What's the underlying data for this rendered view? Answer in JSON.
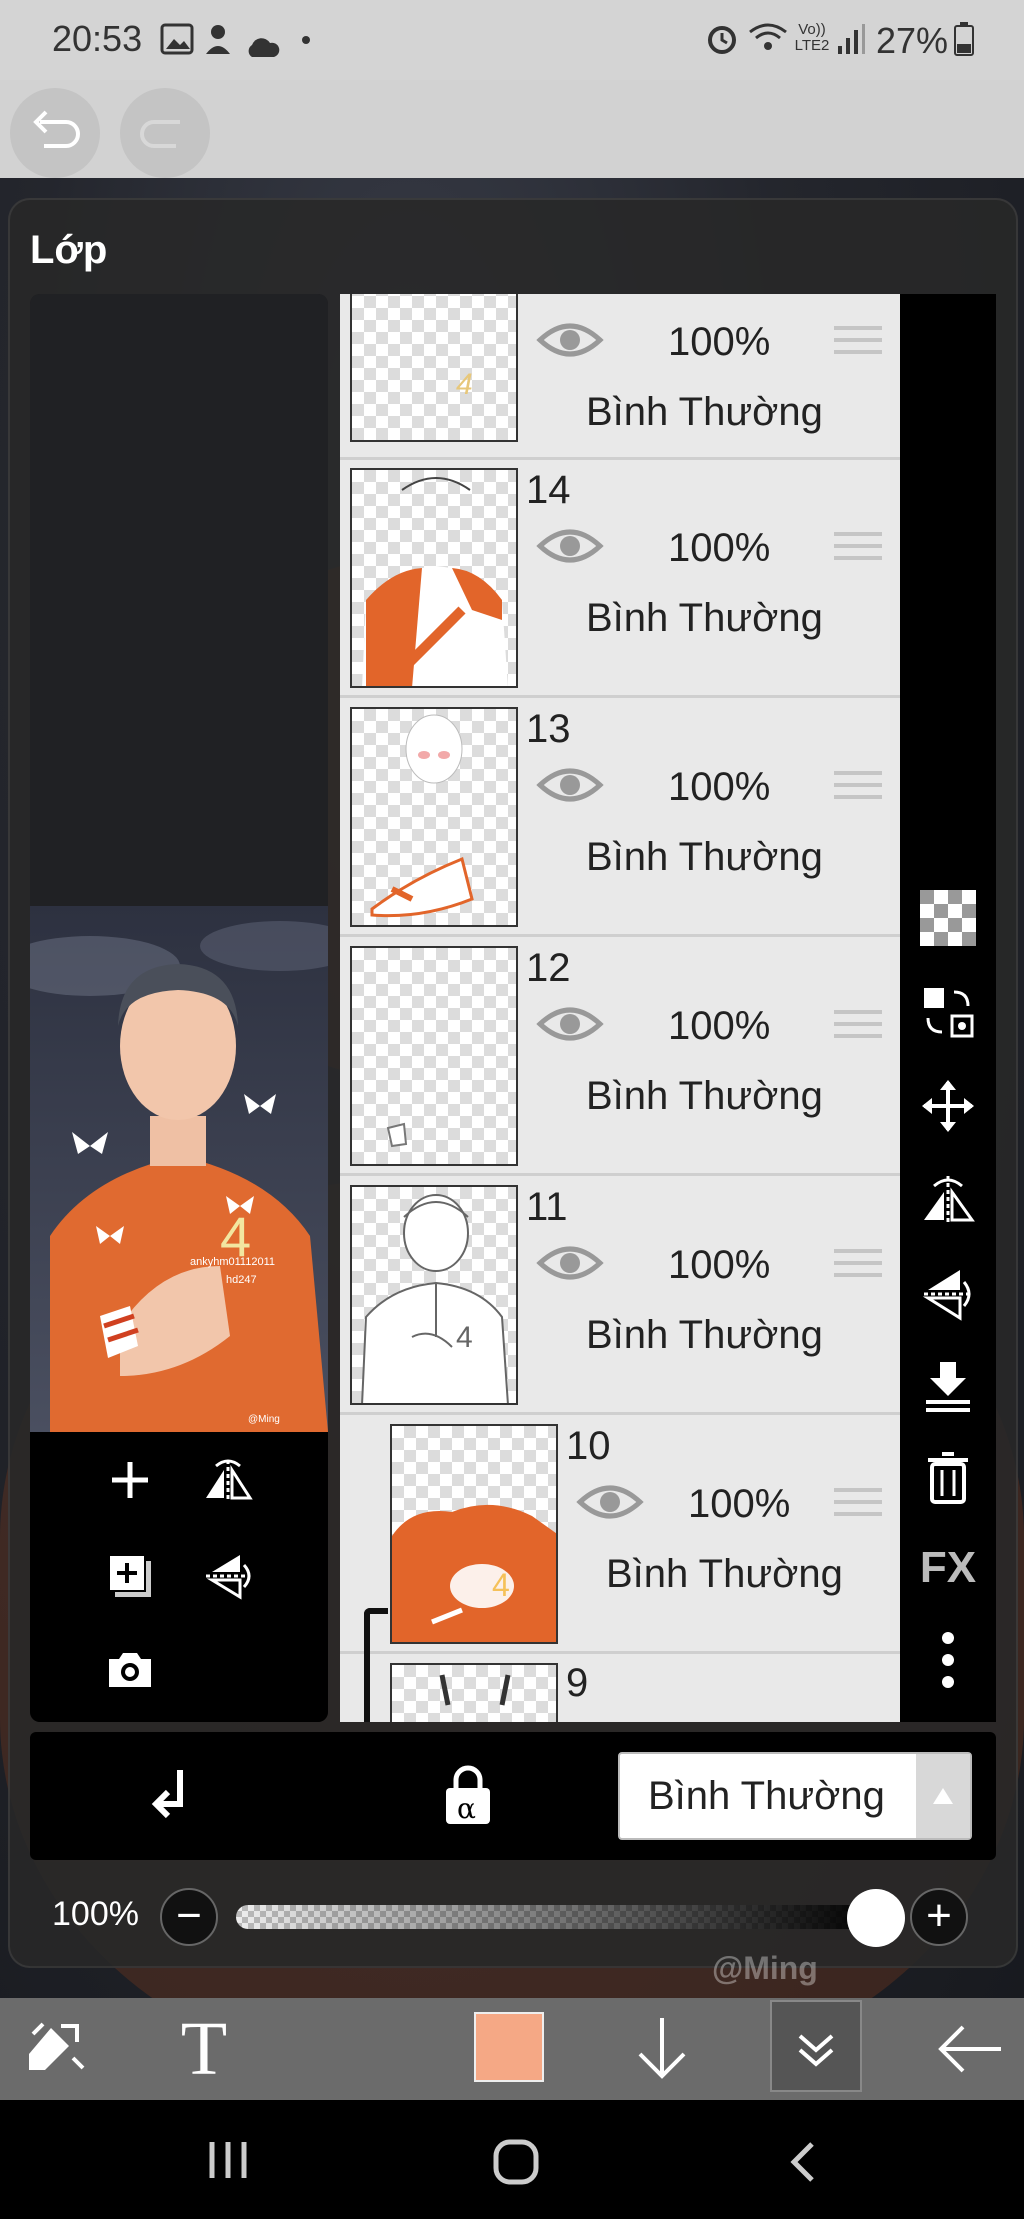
{
  "status_bar": {
    "time": "20:53",
    "network": "Vo)) LTE2",
    "battery": "27%"
  },
  "dialog": {
    "title": "Lớp"
  },
  "preview": {
    "watermark_text": "@Ming",
    "tag_line1": "ankyhm01112011",
    "tag_line2": "hd247",
    "jersey_number": "4"
  },
  "layers": [
    {
      "number": "",
      "opacity": "100%",
      "mode": "Bình Thường"
    },
    {
      "number": "14",
      "opacity": "100%",
      "mode": "Bình Thường"
    },
    {
      "number": "13",
      "opacity": "100%",
      "mode": "Bình Thường"
    },
    {
      "number": "12",
      "opacity": "100%",
      "mode": "Bình Thường"
    },
    {
      "number": "11",
      "opacity": "100%",
      "mode": "Bình Thường"
    },
    {
      "number": "10",
      "opacity": "100%",
      "mode": "Bình Thường"
    },
    {
      "number": "9",
      "opacity": "",
      "mode": ""
    }
  ],
  "right_tools": {
    "fx_label": "FX"
  },
  "blend_mode": {
    "selected": "Bình Thường"
  },
  "opacity": {
    "label": "100%",
    "value_percent": 100
  },
  "canvas_watermark": "@Ming",
  "bottom_toolbar": {
    "text_tool": "T",
    "brush_color": "#f5a885"
  },
  "colors": {
    "accent_orange": "#e2652a",
    "panel_dark": "#1b1b1b"
  }
}
